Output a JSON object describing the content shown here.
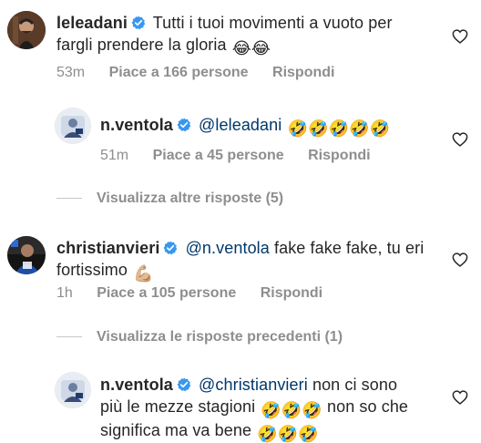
{
  "comments": [
    {
      "username": "leleadani",
      "text": "Tutti i tuoi movimenti a vuoto per fargli prendere la gloria",
      "emojis": "😂😂",
      "time": "53m",
      "likes": "Piace a 166 persone",
      "reply": "Rispondi"
    },
    {
      "username": "n.ventola",
      "mention": "@leleadani",
      "emojis": "🤣🤣🤣🤣🤣",
      "time": "51m",
      "likes": "Piace a 45 persone",
      "reply": "Rispondi"
    },
    {
      "username": "christianvieri",
      "mention": "@n.ventola",
      "text": "fake fake fake, tu eri fortissimo",
      "emojis": "💪🏼",
      "time": "1h",
      "likes": "Piace a 105 persone",
      "reply": "Rispondi"
    },
    {
      "username": "n.ventola",
      "mention": "@christianvieri",
      "text_a": "non ci sono più le mezze stagioni",
      "emojis_a": "🤣🤣🤣",
      "text_b": "non so che significa ma va bene",
      "emojis_b": "🤣🤣🤣"
    }
  ],
  "view_more_replies": "Visualizza altre risposte (5)",
  "view_previous_replies": "Visualizza le risposte precedenti (1)",
  "colors": {
    "text": "#262626",
    "secondary": "#8e8e8e",
    "mention": "#00376b",
    "verified": "#3897f0"
  },
  "icons": [
    "verified-badge-icon",
    "heart-icon"
  ]
}
